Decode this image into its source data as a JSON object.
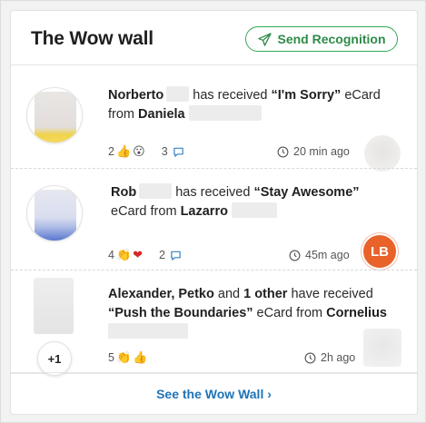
{
  "header": {
    "title": "The Wow wall",
    "send_label": "Send Recognition"
  },
  "items": [
    {
      "recipient": "Norberto",
      "mid": " has received ",
      "card": "“I'm Sorry”",
      "suffix": " eCard",
      "line2_prefix": "from ",
      "sender": "Daniela",
      "likes": "2",
      "comments": "3",
      "time": "20 min ago"
    },
    {
      "recipient": "Rob",
      "mid": " has received ",
      "card": "“Stay Awesome”",
      "line2_prefix": "eCard from ",
      "sender": "Lazarro",
      "likes": "4",
      "comments": "2",
      "time": "45m ago",
      "sender_initials": "LB"
    },
    {
      "recipients_a": "Alexander, Petko",
      "and": " and ",
      "recipients_b": "1 other",
      "mid": " have received",
      "card": "“Push the Boundaries”",
      "line2_mid": " eCard from ",
      "sender": "Cornelius",
      "likes": "5",
      "time": "2h ago",
      "extra_count": "+1"
    }
  ],
  "footer": {
    "link_label": "See the Wow Wall ›"
  },
  "colors": {
    "accent_green": "#34a853",
    "link_blue": "#1f73b7",
    "initials_orange": "#e8622a"
  }
}
